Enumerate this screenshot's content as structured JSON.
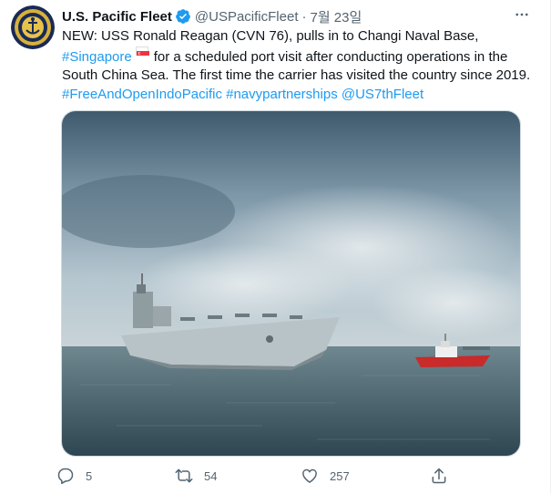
{
  "author": {
    "display_name": "U.S. Pacific Fleet",
    "handle": "@USPacificFleet",
    "separator": "·",
    "date": "7월 23일"
  },
  "tweet": {
    "text_intro": "NEW: USS Ronald Reagan (CVN 76), pulls in to Changi Naval Base,",
    "hashtag_singapore": "#Singapore",
    "text_mid": "for a scheduled port visit after conducting operations in the South China Sea. The first time the carrier has visited the country since 2019.",
    "hashtag_foip": "#FreeAndOpenIndoPacific",
    "hashtag_navy": "#navypartnerships",
    "mention_7th": "@US7thFleet"
  },
  "actions": {
    "replies": "5",
    "retweets": "54",
    "likes": "257"
  },
  "icons": {
    "verified": "verified-badge-icon",
    "more": "more-options-icon",
    "reply": "reply-icon",
    "retweet": "retweet-icon",
    "like": "heart-icon",
    "share": "share-icon",
    "flag": "singapore-flag-icon"
  },
  "colors": {
    "link": "#1d9bf0",
    "secondary_text": "#536471",
    "primary_text": "#0f1419"
  }
}
